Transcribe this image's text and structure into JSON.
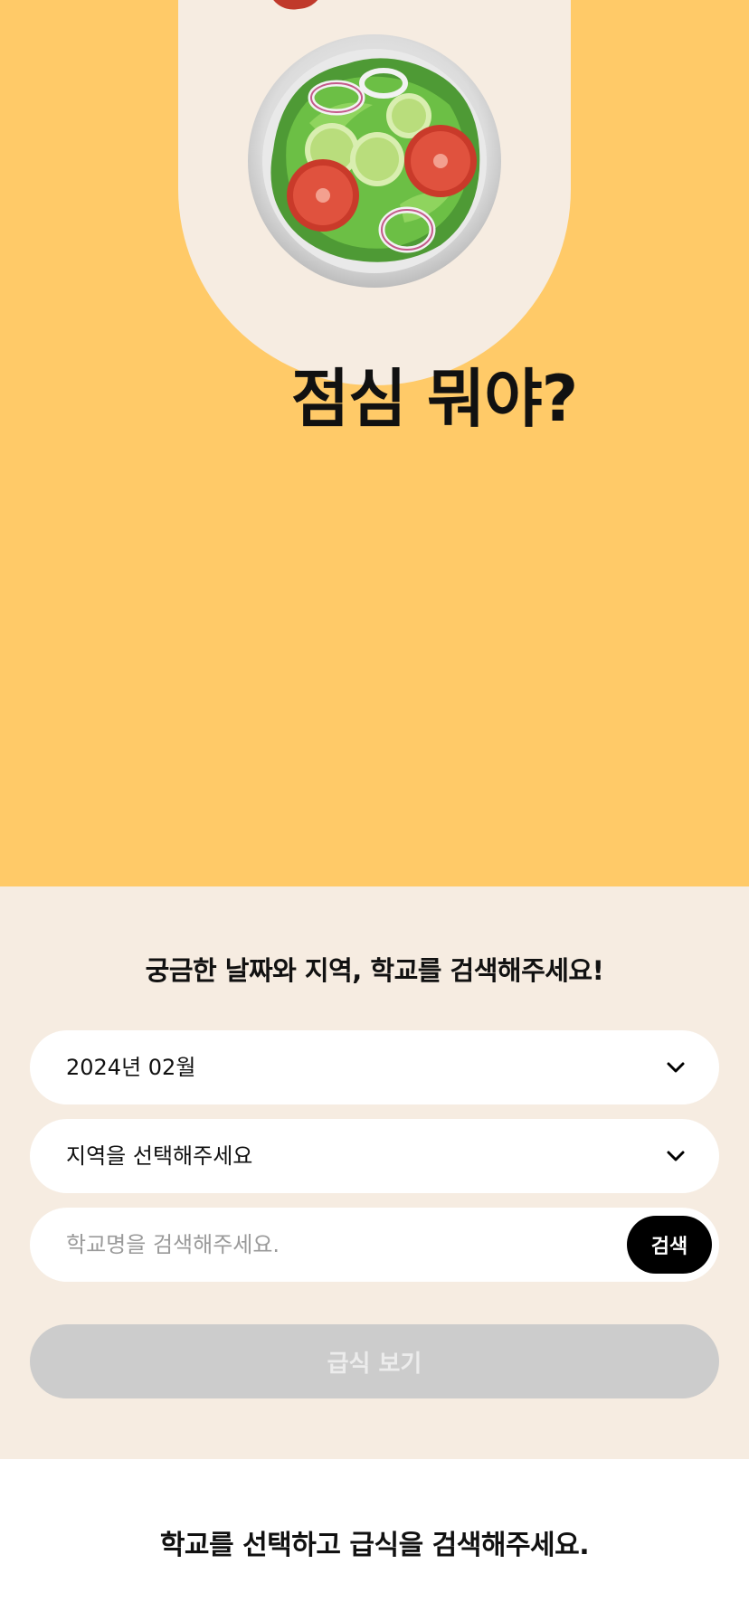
{
  "hero": {
    "title": "점심 뭐야?",
    "illustration": "salad-bowl-icon",
    "background_color": "#ffca68",
    "pill_color": "#f6ece1"
  },
  "search": {
    "heading": "궁금한 날짜와 지역, 학교를 검색해주세요!",
    "month_select": {
      "value": "2024년 02월",
      "icon": "chevron-down-icon"
    },
    "region_select": {
      "value": "지역을 선택해주세요",
      "icon": "chevron-down-icon"
    },
    "school_input": {
      "placeholder": "학교명을 검색해주세요.",
      "value": ""
    },
    "search_button_label": "검색",
    "view_meal_button_label": "급식 보기",
    "background_color": "#f6ece1"
  },
  "results": {
    "message": "학교를 선택하고 급식을 검색해주세요."
  }
}
